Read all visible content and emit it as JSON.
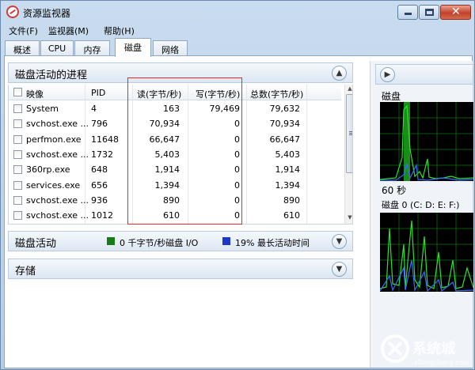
{
  "window": {
    "title": "资源监视器"
  },
  "menu": [
    "文件(F)",
    "监视器(M)",
    "帮助(H)"
  ],
  "tabs": [
    "概述",
    "CPU",
    "内存",
    "磁盘",
    "网络"
  ],
  "active_tab": 3,
  "processes": {
    "title": "磁盘活动的进程",
    "columns": {
      "image": "映像",
      "pid": "PID",
      "read": "读(字节/秒)",
      "write": "写(字节/秒)",
      "total": "总数(字节/秒)"
    },
    "rows": [
      {
        "image": "System",
        "pid": "4",
        "read": "163",
        "write": "79,469",
        "total": "79,632"
      },
      {
        "image": "svchost.exe ...",
        "pid": "796",
        "read": "70,934",
        "write": "0",
        "total": "70,934"
      },
      {
        "image": "perfmon.exe",
        "pid": "11648",
        "read": "66,647",
        "write": "0",
        "total": "66,647"
      },
      {
        "image": "svchost.exe ...",
        "pid": "1732",
        "read": "5,403",
        "write": "0",
        "total": "5,403"
      },
      {
        "image": "360rp.exe",
        "pid": "648",
        "read": "1,914",
        "write": "0",
        "total": "1,914"
      },
      {
        "image": "services.exe",
        "pid": "656",
        "read": "1,394",
        "write": "0",
        "total": "1,394"
      },
      {
        "image": "svchost.exe ...",
        "pid": "936",
        "read": "890",
        "write": "0",
        "total": "890"
      },
      {
        "image": "svchost.exe ...",
        "pid": "1012",
        "read": "610",
        "write": "0",
        "total": "610"
      }
    ]
  },
  "disk_activity": {
    "title": "磁盘活动",
    "io_text": "0 千字节/秒磁盘 I/O",
    "io_color": "#1a7a1a",
    "active_text": "19% 最长活动时间",
    "active_color": "#1c38c8"
  },
  "storage": {
    "title": "存储"
  },
  "right_pane": {
    "disk_label": "磁盘",
    "time_label": "60 秒",
    "disk0_label": "磁盘 0 (C: D: E: F:)"
  },
  "watermark": {
    "text": "系统城",
    "sub": "xitongcheng.com"
  }
}
